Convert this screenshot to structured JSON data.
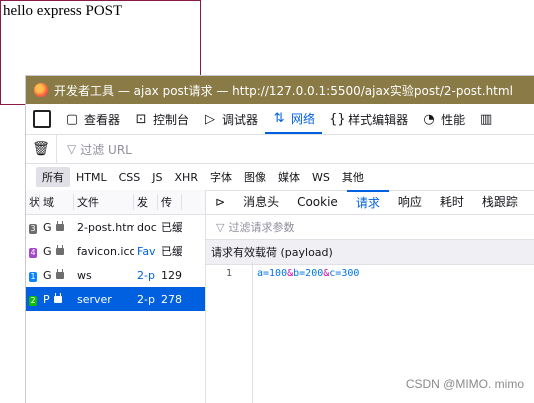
{
  "page": {
    "text": "hello express POST"
  },
  "window": {
    "title": "开发者工具 — ajax post请求 — http://127.0.0.1:5500/ajax实验post/2-post.html"
  },
  "toolbar": [
    {
      "icon": "inspector-icon",
      "label": "查看器"
    },
    {
      "icon": "console-icon",
      "label": "控制台"
    },
    {
      "icon": "debugger-icon",
      "label": "调试器"
    },
    {
      "icon": "network-icon",
      "label": "网络"
    },
    {
      "icon": "style-editor-icon",
      "label": "样式编辑器"
    },
    {
      "icon": "performance-icon",
      "label": "性能"
    }
  ],
  "filter": {
    "placeholder": "过滤 URL"
  },
  "types": [
    "所有",
    "HTML",
    "CSS",
    "JS",
    "XHR",
    "字体",
    "图像",
    "媒体",
    "WS",
    "其他"
  ],
  "columns": [
    "状",
    "域",
    "文件",
    "发",
    "传"
  ],
  "requests": [
    {
      "status": "3",
      "method": "G",
      "file": "2-post.htm",
      "initiator": "doc",
      "transfer": "已缓",
      "color": "#6d6d6d"
    },
    {
      "status": "4",
      "method": "G",
      "file": "favicon.ico",
      "initiator": "Fav",
      "transfer": "已缓",
      "color": "#a347cc"
    },
    {
      "status": "1",
      "method": "G",
      "file": "ws",
      "initiator": "2-p",
      "transfer": "129",
      "color": "#0a84ff"
    },
    {
      "status": "2",
      "method": "P",
      "file": "server",
      "initiator": "2-p",
      "transfer": "278",
      "color": "#12bc00"
    }
  ],
  "detail_tabs": [
    "消息头",
    "Cookie",
    "请求",
    "响应",
    "耗时",
    "栈跟踪"
  ],
  "subfilter": {
    "placeholder": "过滤请求参数"
  },
  "payload": {
    "header": "请求有效载荷 (payload)",
    "line_no": "1",
    "parts": [
      "a=100",
      "&",
      "b=200",
      "&",
      "c=300"
    ]
  },
  "watermark": "CSDN @MIMO. mimo"
}
